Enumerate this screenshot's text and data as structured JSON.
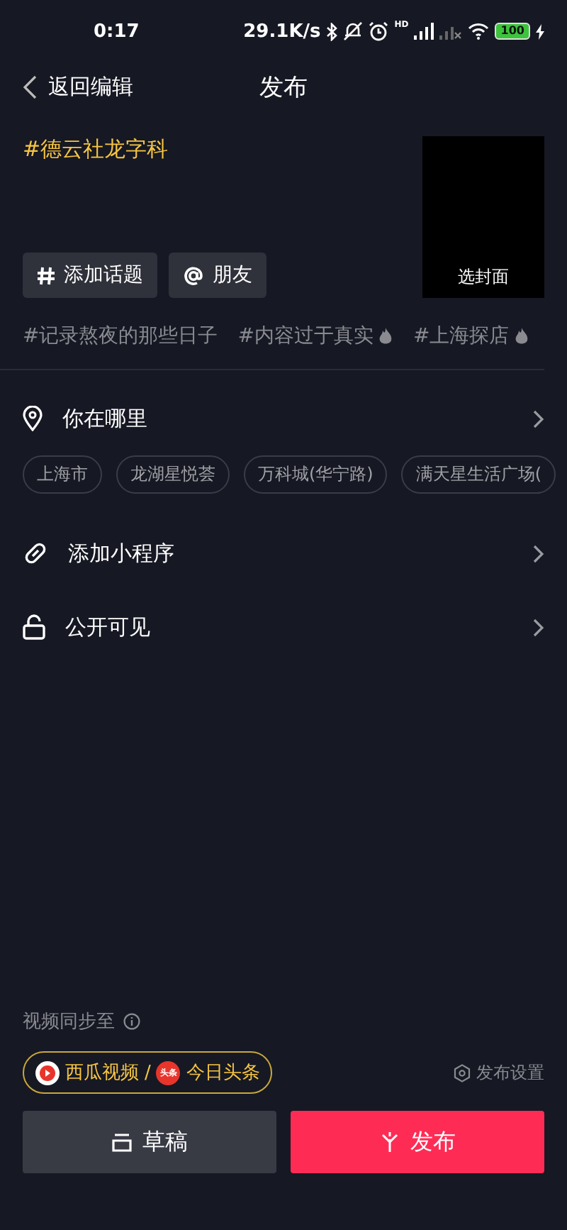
{
  "status_bar": {
    "time": "0:17",
    "speed": "29.1K/s",
    "signal_label": "HD",
    "battery": "100"
  },
  "nav": {
    "back": "返回编辑",
    "title": "发布"
  },
  "caption": {
    "value": "#德云社龙字科"
  },
  "cover": {
    "label": "选封面"
  },
  "insert_buttons": [
    {
      "kind": "hashtag",
      "label": "添加话题"
    },
    {
      "kind": "mention",
      "label": "朋友"
    }
  ],
  "suggested_topics": [
    {
      "label": "#记录熬夜的那些日子",
      "hot": false
    },
    {
      "label": "#内容过于真实",
      "hot": true
    },
    {
      "label": "#上海探店",
      "hot": true
    }
  ],
  "location": {
    "label": "你在哪里",
    "places": [
      "上海市",
      "龙湖星悦荟",
      "万科城(华宁路)",
      "满天星生活广场("
    ]
  },
  "settings": [
    {
      "kind": "mini_program",
      "label": "添加小程序"
    },
    {
      "kind": "visibility",
      "label": "公开可见"
    }
  ],
  "sync": {
    "label": "视频同步至",
    "targets": [
      {
        "kind": "xigua",
        "label": "西瓜视频"
      },
      {
        "kind": "toutiao",
        "label": "今日头条",
        "logo_text": "头条"
      }
    ],
    "separator": "/",
    "settings_label": "发布设置"
  },
  "actions": {
    "draft": "草稿",
    "publish": "发布"
  }
}
